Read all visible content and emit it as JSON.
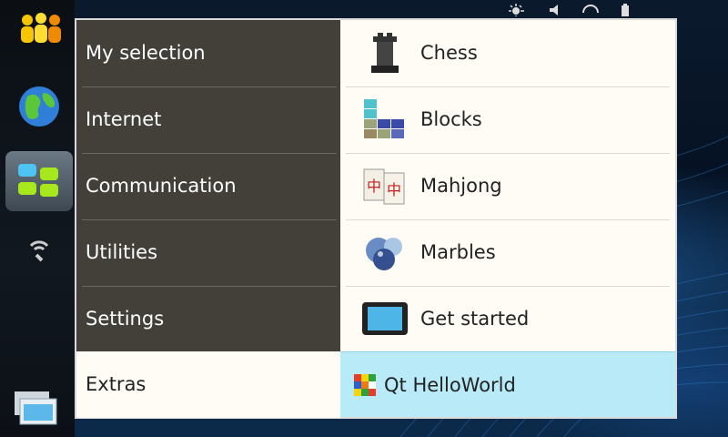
{
  "categories": [
    {
      "label": "My selection"
    },
    {
      "label": "Internet"
    },
    {
      "label": "Communication"
    },
    {
      "label": "Utilities"
    },
    {
      "label": "Settings"
    },
    {
      "label": "Extras"
    }
  ],
  "selected_category": "Extras",
  "apps": [
    {
      "label": "Chess",
      "icon": "chess-rook-icon"
    },
    {
      "label": "Blocks",
      "icon": "blocks-icon"
    },
    {
      "label": "Mahjong",
      "icon": "mahjong-tiles-icon"
    },
    {
      "label": "Marbles",
      "icon": "marbles-icon"
    },
    {
      "label": "Get started",
      "icon": "tablet-device-icon"
    },
    {
      "label": "Qt HelloWorld",
      "icon": "rubiks-cube-icon"
    }
  ],
  "dock": [
    {
      "icon": "contacts-icon"
    },
    {
      "icon": "web-globe-icon"
    },
    {
      "icon": "applications-grid-icon"
    },
    {
      "icon": "wireless-settings-icon"
    },
    {
      "icon": "task-switcher-icon"
    }
  ],
  "colors": {
    "category_bg": "#424039",
    "panel_bg": "#fffcf5",
    "highlight_bg": "#b8eaf8"
  }
}
